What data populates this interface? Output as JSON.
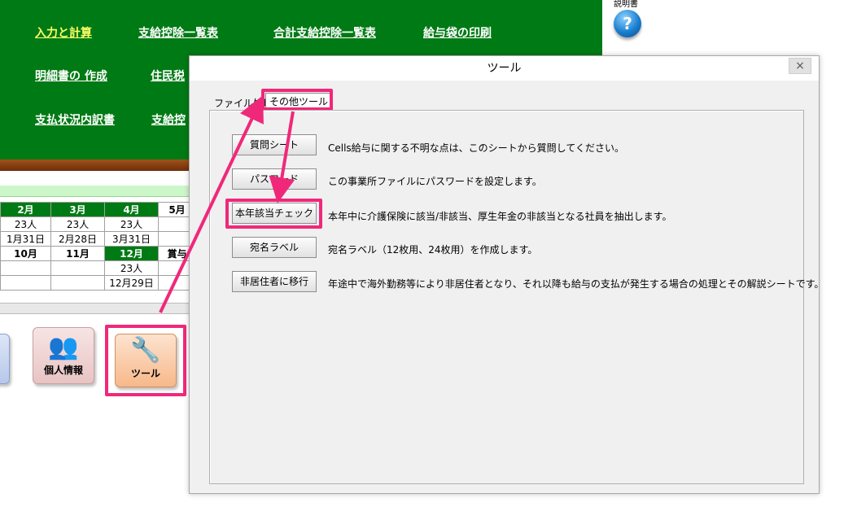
{
  "background": {
    "nav": [
      "入力と計算",
      "支給控除一覧表",
      "合計支給控除一覧表",
      "給与袋の印刷",
      "明細書の 作成",
      "住民税",
      "支払状況内訳書",
      "支給控"
    ],
    "help_label": "説明書",
    "help_glyph": "?",
    "calendar": {
      "months_top": [
        "2月",
        "3月",
        "4月",
        "5月"
      ],
      "counts_top": [
        "23人",
        "23人",
        "23人"
      ],
      "dates_top": [
        "1月31日",
        "2月28日",
        "3月31日"
      ],
      "months_bottom": [
        "10月",
        "11月",
        "12月",
        "賞与"
      ],
      "count_bottom": "23人",
      "date_bottom": "12月29日"
    },
    "icon_buttons": {
      "personal_info": "個人情報",
      "tools": "ツール"
    }
  },
  "dialog": {
    "title": "ツール",
    "close_glyph": "×",
    "tabs": [
      "ファイル処理",
      "その他ツール"
    ],
    "rows": [
      {
        "button": "質問シート",
        "description": "Cells給与に関する不明な点は、このシートから質問してください。"
      },
      {
        "button": "パスワード",
        "description": "この事業所ファイルにパスワードを設定します。"
      },
      {
        "button": "本年該当チェック",
        "description": "本年中に介護保険に該当/非該当、厚生年金の非該当となる社員を抽出します。"
      },
      {
        "button": "宛名ラベル",
        "description": "宛名ラベル（12枚用、24枚用）を作成します。"
      },
      {
        "button": "非居住者に移行",
        "description": "年途中で海外勤務等により非居住者となり、それ以降も給与の支払が発生する場合の処理とその解説シートです。"
      }
    ]
  },
  "colors": {
    "green_panel": "#007a14",
    "highlight": "#f0287a"
  }
}
